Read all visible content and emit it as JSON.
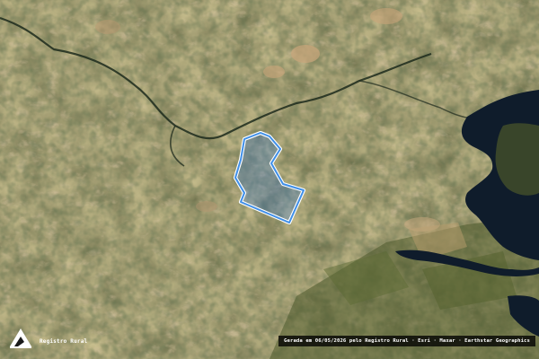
{
  "map": {
    "type": "satellite",
    "colors": {
      "vegetation_dark": "#2f3a1e",
      "vegetation": "#4a5530",
      "bare_soil": "#a8875a",
      "water": "#0e1b2a",
      "polygon_stroke": "#4aa3ff",
      "polygon_fill": "#3c78c8"
    }
  },
  "branding": {
    "logo_icon": "registro-rural-logo-icon",
    "logo_text": "Registro Rural"
  },
  "attribution": {
    "text": "Gerada em 06/05/2026 pelo Registro Rural · Esri · Maxar · Earthstar Geographics"
  }
}
